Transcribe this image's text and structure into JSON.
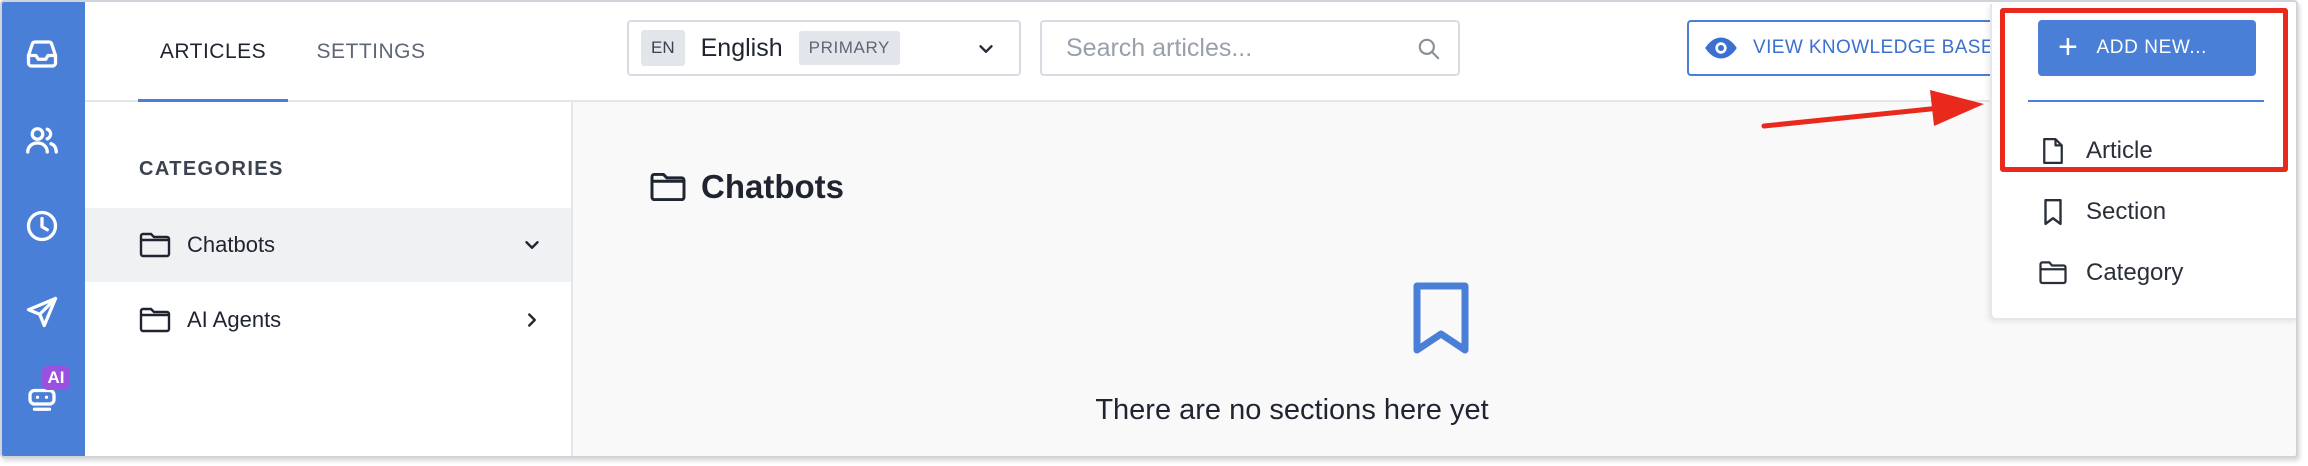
{
  "rail": {
    "items": [
      {
        "name": "inbox"
      },
      {
        "name": "contacts"
      },
      {
        "name": "history"
      },
      {
        "name": "campaigns"
      },
      {
        "name": "ai-bot"
      }
    ],
    "ai_badge": "AI"
  },
  "topbar": {
    "tabs": [
      {
        "label": "ARTICLES",
        "active": true
      },
      {
        "label": "SETTINGS",
        "active": false
      }
    ],
    "language": {
      "code": "EN",
      "name": "English",
      "tag": "PRIMARY"
    },
    "search": {
      "placeholder": "Search articles...",
      "value": ""
    },
    "view_kb_label": "VIEW KNOWLEDGE BASE"
  },
  "categories": {
    "heading": "CATEGORIES",
    "items": [
      {
        "label": "Chatbots",
        "expanded": true,
        "selected": true
      },
      {
        "label": "AI Agents",
        "expanded": false,
        "selected": false
      }
    ]
  },
  "main": {
    "title": "Chatbots",
    "empty_text": "There are no sections here yet"
  },
  "dropdown": {
    "add_new_label": "ADD NEW...",
    "items": [
      {
        "label": "Article",
        "icon": "document-icon"
      },
      {
        "label": "Section",
        "icon": "bookmark-icon"
      },
      {
        "label": "Category",
        "icon": "folder-icon"
      }
    ]
  },
  "colors": {
    "accent": "#4a7fd8",
    "highlight": "#e8291c",
    "ai_badge": "#9b51e0"
  }
}
